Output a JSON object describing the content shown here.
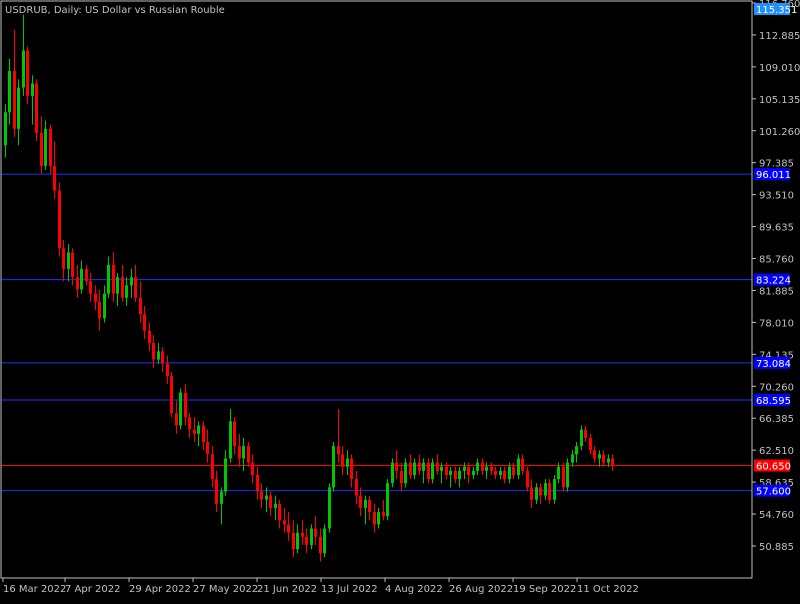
{
  "window": {
    "title": "USDRUB, Daily:  US Dollar vs Russian Rouble"
  },
  "colors": {
    "background": "#000000",
    "frame": "#c0c0c0",
    "text": "#c0c0c0",
    "bull": "#00c800",
    "bear": "#ff0000",
    "level_line": "#1a33ff",
    "level_label_bg": "#0000ff",
    "current_price_line": "#ff0000",
    "current_price_label_bg": "#ff0000",
    "top_label_bg": "#1e90ff"
  },
  "chart_data": {
    "type": "candlestick",
    "title": "USDRUB, Daily:  US Dollar vs Russian Rouble",
    "symbol": "USDRUB",
    "timeframe": "Daily",
    "ylim": [
      47.0,
      116.76
    ],
    "y_ticks": [
      "116.760",
      "112.885",
      "109.010",
      "105.135",
      "101.260",
      "97.385",
      "93.510",
      "89.635",
      "85.760",
      "81.885",
      "78.010",
      "74.135",
      "70.260",
      "66.385",
      "62.510",
      "58.635",
      "54.760",
      "50.885"
    ],
    "x_ticks": [
      "16 Mar 2022",
      "7 Apr 2022",
      "29 Apr 2022",
      "27 May 2022",
      "21 Jun 2022",
      "13 Jul 2022",
      "4 Aug 2022",
      "26 Aug 2022",
      "19 Sep 2022",
      "11 Oct 2022"
    ],
    "top_price_label": "115.351",
    "current_price": {
      "value": 60.65,
      "label": "60.650"
    },
    "horizontal_levels": [
      {
        "value": 96.0,
        "label": "96.011"
      },
      {
        "value": 83.2,
        "label": "83.224"
      },
      {
        "value": 73.1,
        "label": "73.084"
      },
      {
        "value": 68.6,
        "label": "68.595"
      },
      {
        "value": 57.6,
        "label": "57.600"
      }
    ],
    "candles": [
      {
        "o": 99.5,
        "h": 104.5,
        "l": 98.0,
        "c": 103.5
      },
      {
        "o": 103.5,
        "h": 110.0,
        "l": 102.0,
        "c": 108.5
      },
      {
        "o": 108.5,
        "h": 113.5,
        "l": 100.5,
        "c": 101.5
      },
      {
        "o": 101.5,
        "h": 107.5,
        "l": 99.5,
        "c": 106.5
      },
      {
        "o": 106.5,
        "h": 115.35,
        "l": 105.5,
        "c": 111.0
      },
      {
        "o": 111.0,
        "h": 111.5,
        "l": 104.5,
        "c": 105.5
      },
      {
        "o": 105.5,
        "h": 108.0,
        "l": 102.0,
        "c": 107.0
      },
      {
        "o": 107.0,
        "h": 107.5,
        "l": 100.0,
        "c": 101.0
      },
      {
        "o": 101.0,
        "h": 103.0,
        "l": 96.0,
        "c": 97.0
      },
      {
        "o": 97.0,
        "h": 102.5,
        "l": 96.5,
        "c": 101.5
      },
      {
        "o": 101.5,
        "h": 102.0,
        "l": 96.0,
        "c": 97.0
      },
      {
        "o": 97.0,
        "h": 100.0,
        "l": 93.0,
        "c": 94.0
      },
      {
        "o": 94.0,
        "h": 95.0,
        "l": 86.0,
        "c": 87.0
      },
      {
        "o": 87.0,
        "h": 88.0,
        "l": 83.0,
        "c": 84.5
      },
      {
        "o": 84.5,
        "h": 87.5,
        "l": 83.0,
        "c": 86.5
      },
      {
        "o": 86.5,
        "h": 87.0,
        "l": 82.5,
        "c": 83.5
      },
      {
        "o": 83.5,
        "h": 85.0,
        "l": 81.0,
        "c": 82.0
      },
      {
        "o": 82.0,
        "h": 85.5,
        "l": 81.5,
        "c": 84.5
      },
      {
        "o": 84.5,
        "h": 85.0,
        "l": 82.5,
        "c": 83.0
      },
      {
        "o": 83.0,
        "h": 84.0,
        "l": 80.5,
        "c": 81.5
      },
      {
        "o": 81.5,
        "h": 82.5,
        "l": 79.5,
        "c": 80.5
      },
      {
        "o": 80.5,
        "h": 82.0,
        "l": 77.0,
        "c": 78.5
      },
      {
        "o": 78.5,
        "h": 82.5,
        "l": 78.0,
        "c": 81.5
      },
      {
        "o": 81.5,
        "h": 86.0,
        "l": 81.0,
        "c": 85.0
      },
      {
        "o": 85.0,
        "h": 86.5,
        "l": 80.5,
        "c": 81.5
      },
      {
        "o": 81.5,
        "h": 84.0,
        "l": 80.0,
        "c": 83.5
      },
      {
        "o": 83.5,
        "h": 85.0,
        "l": 80.5,
        "c": 81.0
      },
      {
        "o": 81.0,
        "h": 83.5,
        "l": 80.0,
        "c": 82.5
      },
      {
        "o": 82.5,
        "h": 84.5,
        "l": 81.0,
        "c": 83.5
      },
      {
        "o": 83.5,
        "h": 85.0,
        "l": 80.5,
        "c": 81.0
      },
      {
        "o": 81.0,
        "h": 83.0,
        "l": 78.0,
        "c": 79.0
      },
      {
        "o": 79.0,
        "h": 80.0,
        "l": 76.0,
        "c": 77.0
      },
      {
        "o": 77.0,
        "h": 78.0,
        "l": 74.5,
        "c": 75.5
      },
      {
        "o": 75.5,
        "h": 76.5,
        "l": 72.5,
        "c": 73.5
      },
      {
        "o": 73.5,
        "h": 75.5,
        "l": 73.0,
        "c": 74.5
      },
      {
        "o": 74.5,
        "h": 75.0,
        "l": 72.0,
        "c": 73.0
      },
      {
        "o": 73.0,
        "h": 74.0,
        "l": 70.5,
        "c": 71.5
      },
      {
        "o": 71.5,
        "h": 72.0,
        "l": 66.5,
        "c": 67.0
      },
      {
        "o": 67.0,
        "h": 68.5,
        "l": 64.5,
        "c": 65.5
      },
      {
        "o": 65.5,
        "h": 70.0,
        "l": 65.0,
        "c": 69.5
      },
      {
        "o": 69.5,
        "h": 70.5,
        "l": 65.5,
        "c": 66.5
      },
      {
        "o": 66.5,
        "h": 67.0,
        "l": 64.0,
        "c": 65.0
      },
      {
        "o": 65.0,
        "h": 66.5,
        "l": 63.5,
        "c": 64.5
      },
      {
        "o": 64.5,
        "h": 66.0,
        "l": 63.0,
        "c": 65.5
      },
      {
        "o": 65.5,
        "h": 66.0,
        "l": 62.5,
        "c": 63.5
      },
      {
        "o": 63.5,
        "h": 65.0,
        "l": 61.0,
        "c": 62.0
      },
      {
        "o": 62.0,
        "h": 63.0,
        "l": 58.0,
        "c": 59.0
      },
      {
        "o": 59.0,
        "h": 60.0,
        "l": 55.0,
        "c": 56.0
      },
      {
        "o": 56.0,
        "h": 58.0,
        "l": 53.5,
        "c": 57.5
      },
      {
        "o": 57.5,
        "h": 62.5,
        "l": 57.0,
        "c": 61.5
      },
      {
        "o": 61.5,
        "h": 67.5,
        "l": 61.0,
        "c": 66.0
      },
      {
        "o": 66.0,
        "h": 66.5,
        "l": 62.0,
        "c": 63.0
      },
      {
        "o": 63.0,
        "h": 64.5,
        "l": 60.5,
        "c": 61.5
      },
      {
        "o": 61.5,
        "h": 64.0,
        "l": 60.0,
        "c": 63.0
      },
      {
        "o": 63.0,
        "h": 63.5,
        "l": 60.5,
        "c": 61.0
      },
      {
        "o": 61.0,
        "h": 62.0,
        "l": 58.5,
        "c": 59.5
      },
      {
        "o": 59.5,
        "h": 60.5,
        "l": 56.5,
        "c": 57.5
      },
      {
        "o": 57.5,
        "h": 58.5,
        "l": 55.5,
        "c": 56.5
      },
      {
        "o": 56.5,
        "h": 58.0,
        "l": 55.0,
        "c": 57.0
      },
      {
        "o": 57.0,
        "h": 57.5,
        "l": 54.5,
        "c": 55.5
      },
      {
        "o": 55.5,
        "h": 57.0,
        "l": 54.0,
        "c": 56.0
      },
      {
        "o": 56.0,
        "h": 56.5,
        "l": 53.0,
        "c": 54.0
      },
      {
        "o": 54.0,
        "h": 55.5,
        "l": 52.5,
        "c": 53.5
      },
      {
        "o": 53.5,
        "h": 55.0,
        "l": 51.5,
        "c": 52.5
      },
      {
        "o": 52.5,
        "h": 54.0,
        "l": 49.5,
        "c": 50.5
      },
      {
        "o": 50.5,
        "h": 53.5,
        "l": 50.0,
        "c": 52.5
      },
      {
        "o": 52.5,
        "h": 54.0,
        "l": 51.0,
        "c": 52.0
      },
      {
        "o": 52.0,
        "h": 53.0,
        "l": 50.0,
        "c": 51.0
      },
      {
        "o": 51.0,
        "h": 53.5,
        "l": 50.5,
        "c": 53.0
      },
      {
        "o": 53.0,
        "h": 54.5,
        "l": 51.0,
        "c": 52.0
      },
      {
        "o": 52.0,
        "h": 53.0,
        "l": 49.0,
        "c": 50.0
      },
      {
        "o": 50.0,
        "h": 53.5,
        "l": 49.5,
        "c": 53.0
      },
      {
        "o": 53.0,
        "h": 58.5,
        "l": 52.5,
        "c": 58.0
      },
      {
        "o": 58.0,
        "h": 63.5,
        "l": 57.5,
        "c": 63.0
      },
      {
        "o": 63.0,
        "h": 67.5,
        "l": 61.0,
        "c": 62.0
      },
      {
        "o": 62.0,
        "h": 63.0,
        "l": 59.5,
        "c": 60.5
      },
      {
        "o": 60.5,
        "h": 62.5,
        "l": 59.5,
        "c": 61.5
      },
      {
        "o": 61.5,
        "h": 62.0,
        "l": 58.0,
        "c": 59.0
      },
      {
        "o": 59.0,
        "h": 60.0,
        "l": 56.0,
        "c": 57.0
      },
      {
        "o": 57.0,
        "h": 58.0,
        "l": 54.5,
        "c": 55.5
      },
      {
        "o": 55.5,
        "h": 57.0,
        "l": 53.5,
        "c": 56.5
      },
      {
        "o": 56.5,
        "h": 57.0,
        "l": 54.0,
        "c": 55.0
      },
      {
        "o": 55.0,
        "h": 56.0,
        "l": 52.5,
        "c": 53.5
      },
      {
        "o": 53.5,
        "h": 55.5,
        "l": 53.0,
        "c": 55.0
      },
      {
        "o": 55.0,
        "h": 56.5,
        "l": 54.0,
        "c": 54.5
      },
      {
        "o": 54.5,
        "h": 59.0,
        "l": 54.0,
        "c": 58.5
      },
      {
        "o": 58.5,
        "h": 61.5,
        "l": 58.0,
        "c": 61.0
      },
      {
        "o": 61.0,
        "h": 62.5,
        "l": 59.0,
        "c": 60.0
      },
      {
        "o": 60.0,
        "h": 61.0,
        "l": 57.5,
        "c": 58.5
      },
      {
        "o": 58.5,
        "h": 61.5,
        "l": 58.0,
        "c": 61.0
      },
      {
        "o": 61.0,
        "h": 62.0,
        "l": 59.0,
        "c": 59.5
      },
      {
        "o": 59.5,
        "h": 61.5,
        "l": 59.0,
        "c": 61.0
      },
      {
        "o": 61.0,
        "h": 62.0,
        "l": 59.5,
        "c": 60.0
      },
      {
        "o": 60.0,
        "h": 61.5,
        "l": 58.5,
        "c": 61.0
      },
      {
        "o": 61.0,
        "h": 61.5,
        "l": 58.5,
        "c": 59.0
      },
      {
        "o": 59.0,
        "h": 61.5,
        "l": 58.5,
        "c": 61.0
      },
      {
        "o": 61.0,
        "h": 62.0,
        "l": 59.5,
        "c": 60.0
      },
      {
        "o": 60.0,
        "h": 61.0,
        "l": 58.5,
        "c": 60.5
      },
      {
        "o": 60.5,
        "h": 61.0,
        "l": 59.0,
        "c": 59.5
      },
      {
        "o": 59.5,
        "h": 60.5,
        "l": 58.0,
        "c": 60.0
      },
      {
        "o": 60.0,
        "h": 60.5,
        "l": 58.5,
        "c": 59.0
      },
      {
        "o": 59.0,
        "h": 60.5,
        "l": 58.0,
        "c": 60.0
      },
      {
        "o": 60.0,
        "h": 61.0,
        "l": 59.0,
        "c": 60.5
      },
      {
        "o": 60.5,
        "h": 61.0,
        "l": 58.5,
        "c": 59.5
      },
      {
        "o": 59.5,
        "h": 60.5,
        "l": 59.0,
        "c": 60.0
      },
      {
        "o": 60.0,
        "h": 61.5,
        "l": 59.5,
        "c": 61.0
      },
      {
        "o": 61.0,
        "h": 61.5,
        "l": 59.5,
        "c": 60.0
      },
      {
        "o": 60.0,
        "h": 61.0,
        "l": 59.0,
        "c": 60.5
      },
      {
        "o": 60.5,
        "h": 61.0,
        "l": 59.5,
        "c": 60.0
      },
      {
        "o": 60.0,
        "h": 60.5,
        "l": 59.0,
        "c": 59.5
      },
      {
        "o": 59.5,
        "h": 60.5,
        "l": 59.0,
        "c": 60.0
      },
      {
        "o": 60.0,
        "h": 60.5,
        "l": 58.5,
        "c": 59.0
      },
      {
        "o": 59.0,
        "h": 61.0,
        "l": 58.5,
        "c": 60.5
      },
      {
        "o": 60.5,
        "h": 61.0,
        "l": 59.0,
        "c": 59.5
      },
      {
        "o": 59.5,
        "h": 62.0,
        "l": 59.0,
        "c": 61.5
      },
      {
        "o": 61.5,
        "h": 62.0,
        "l": 59.5,
        "c": 60.0
      },
      {
        "o": 60.0,
        "h": 60.5,
        "l": 57.5,
        "c": 58.0
      },
      {
        "o": 58.0,
        "h": 59.0,
        "l": 55.5,
        "c": 56.5
      },
      {
        "o": 56.5,
        "h": 58.5,
        "l": 56.0,
        "c": 58.0
      },
      {
        "o": 58.0,
        "h": 58.5,
        "l": 56.0,
        "c": 57.0
      },
      {
        "o": 57.0,
        "h": 59.0,
        "l": 56.5,
        "c": 58.5
      },
      {
        "o": 58.5,
        "h": 59.0,
        "l": 56.0,
        "c": 56.5
      },
      {
        "o": 56.5,
        "h": 59.5,
        "l": 56.0,
        "c": 59.0
      },
      {
        "o": 59.0,
        "h": 61.0,
        "l": 58.5,
        "c": 60.5
      },
      {
        "o": 60.5,
        "h": 61.0,
        "l": 57.5,
        "c": 58.0
      },
      {
        "o": 58.0,
        "h": 61.5,
        "l": 57.5,
        "c": 61.0
      },
      {
        "o": 61.0,
        "h": 62.5,
        "l": 60.5,
        "c": 62.0
      },
      {
        "o": 62.0,
        "h": 63.5,
        "l": 61.0,
        "c": 63.0
      },
      {
        "o": 63.0,
        "h": 65.5,
        "l": 62.5,
        "c": 65.0
      },
      {
        "o": 65.0,
        "h": 65.5,
        "l": 63.5,
        "c": 64.0
      },
      {
        "o": 64.0,
        "h": 64.5,
        "l": 62.0,
        "c": 62.5
      },
      {
        "o": 62.5,
        "h": 63.0,
        "l": 61.0,
        "c": 61.5
      },
      {
        "o": 61.5,
        "h": 62.5,
        "l": 60.5,
        "c": 62.0
      },
      {
        "o": 62.0,
        "h": 62.5,
        "l": 60.5,
        "c": 61.0
      },
      {
        "o": 61.0,
        "h": 62.0,
        "l": 60.5,
        "c": 61.5
      },
      {
        "o": 61.5,
        "h": 62.0,
        "l": 60.0,
        "c": 60.65
      }
    ]
  }
}
